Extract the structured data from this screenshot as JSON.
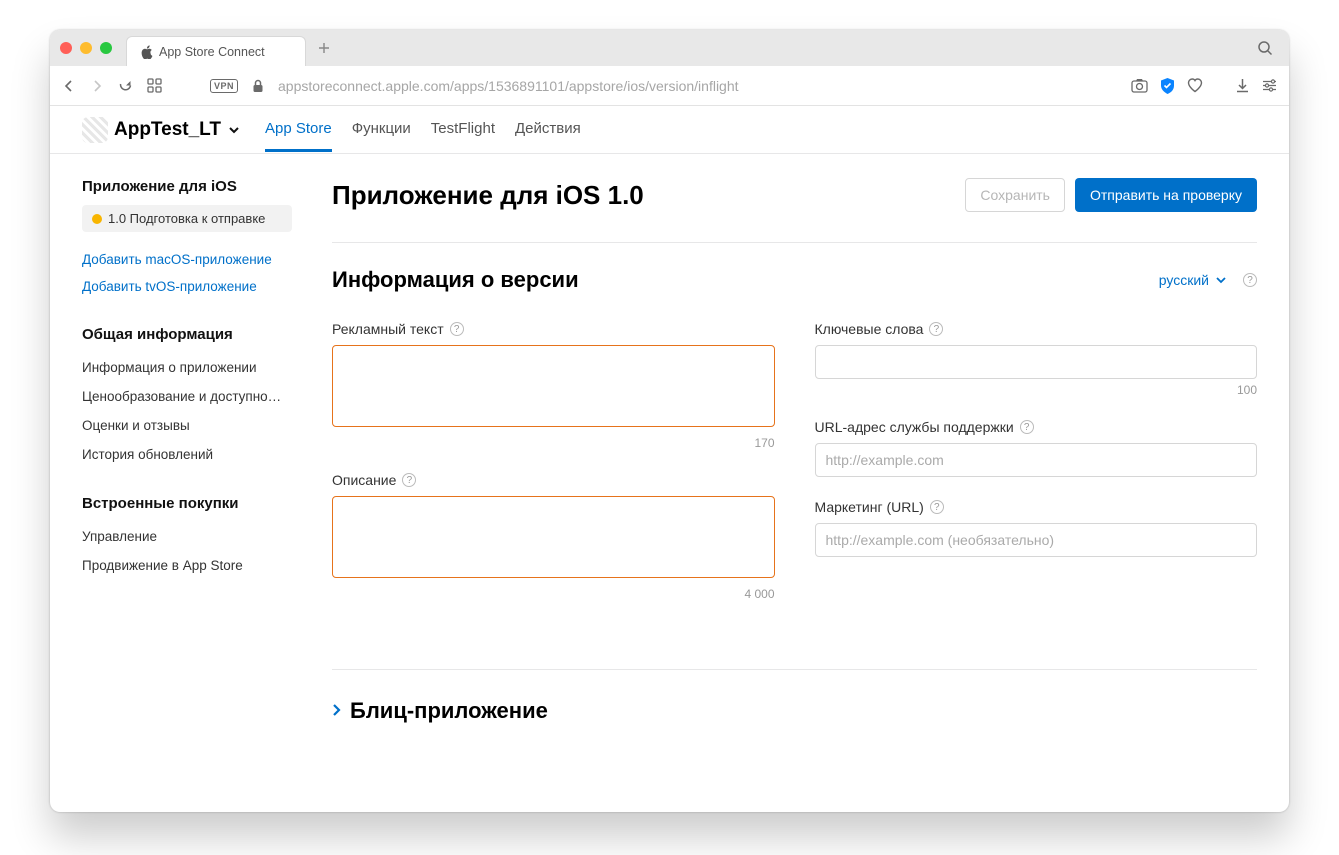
{
  "tab": {
    "title": "App Store Connect"
  },
  "url": "appstoreconnect.apple.com/apps/1536891101/appstore/ios/version/inflight",
  "header": {
    "appName": "AppTest_LT",
    "tabs": [
      "App Store",
      "Функции",
      "TestFlight",
      "Действия"
    ]
  },
  "sidebar": {
    "iosHeading": "Приложение для iOS",
    "version": "1.0 Подготовка к отправке",
    "addMacos": "Добавить macOS-приложение",
    "addTvos": "Добавить tvOS-приложение",
    "generalHeading": "Общая информация",
    "general": [
      "Информация о приложении",
      "Ценообразование и доступно…",
      "Оценки и отзывы",
      "История обновлений"
    ],
    "iapHeading": "Встроенные покупки",
    "iap": [
      "Управление",
      "Продвижение в App Store"
    ]
  },
  "page": {
    "title": "Приложение для iOS 1.0",
    "saveBtn": "Сохранить",
    "submitBtn": "Отправить на проверку",
    "sectionTitle": "Информация о версии",
    "lang": "русский",
    "promoLabel": "Рекламный текст",
    "promoCounter": "170",
    "descLabel": "Описание",
    "descCounter": "4 000",
    "keywordsLabel": "Ключевые слова",
    "keywordsCounter": "100",
    "supportUrlLabel": "URL-адрес службы поддержки",
    "supportUrlPlaceholder": "http://example.com",
    "marketingUrlLabel": "Маркетинг (URL)",
    "marketingUrlPlaceholder": "http://example.com (необязательно)",
    "appClip": "Блиц-приложение"
  }
}
